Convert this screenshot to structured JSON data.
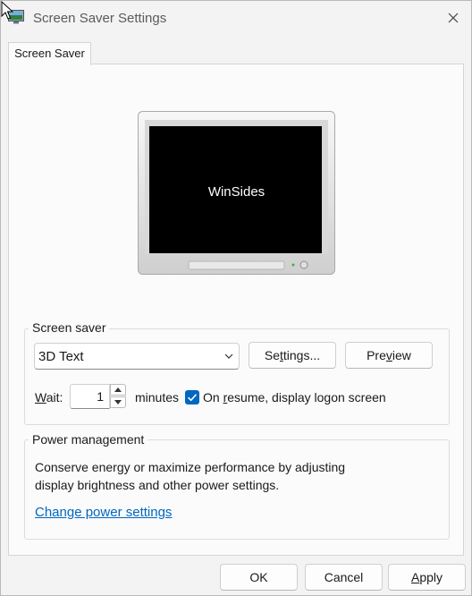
{
  "window": {
    "title": "Screen Saver Settings",
    "tab": "Screen Saver"
  },
  "preview": {
    "text": "WinSides"
  },
  "screen_saver": {
    "group_label": "Screen saver",
    "selected": "3D Text",
    "settings_button": {
      "pre": "Se",
      "key": "t",
      "post": "tings..."
    },
    "preview_button": {
      "pre": "Pre",
      "key": "v",
      "post": "iew"
    },
    "wait_label": {
      "key": "W",
      "post": "ait:"
    },
    "wait_value": "1",
    "minutes_label": "minutes",
    "resume_checked": true,
    "resume_label": {
      "pre": "On ",
      "key": "r",
      "post": "esume, display logon screen"
    }
  },
  "power": {
    "group_label": "Power management",
    "description_line1": "Conserve energy or maximize performance by adjusting",
    "description_line2": "display brightness and other power settings.",
    "link": "Change power settings"
  },
  "footer": {
    "ok": "OK",
    "cancel": "Cancel",
    "apply": {
      "key": "A",
      "post": "pply"
    }
  },
  "colors": {
    "accent": "#0067c0",
    "window_bg": "#f3f3f3",
    "panel_bg": "#fbfbfb"
  }
}
